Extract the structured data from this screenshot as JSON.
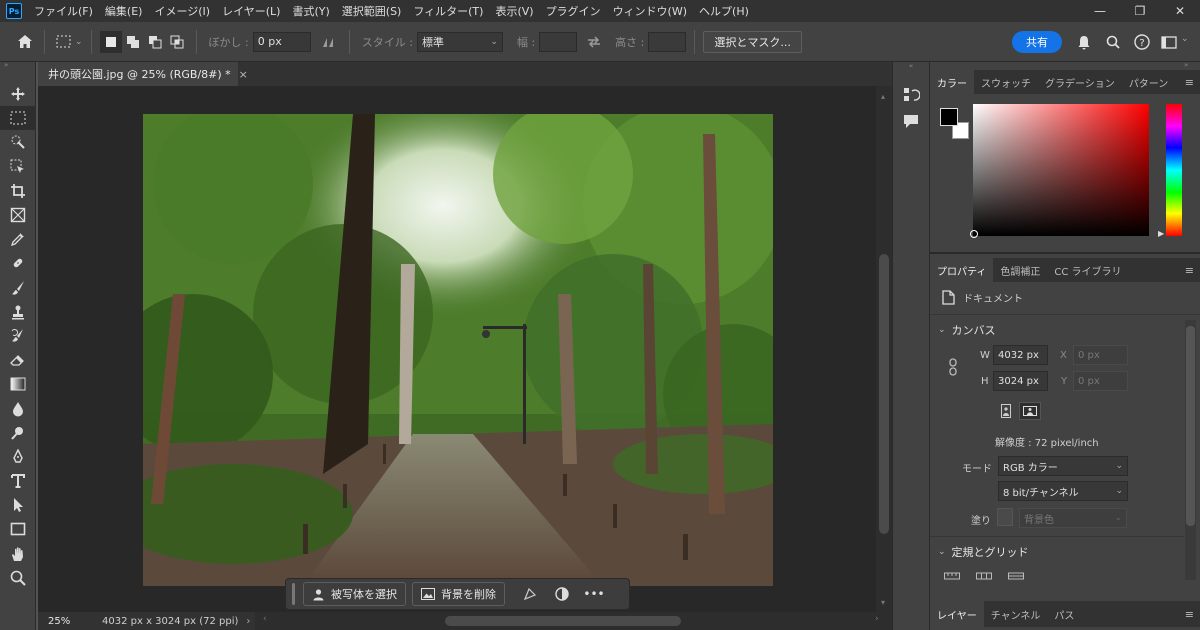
{
  "menu": {
    "logo": "Ps",
    "items": [
      "ファイル(F)",
      "編集(E)",
      "イメージ(I)",
      "レイヤー(L)",
      "書式(Y)",
      "選択範囲(S)",
      "フィルター(T)",
      "表示(V)",
      "プラグイン",
      "ウィンドウ(W)",
      "ヘルプ(H)"
    ],
    "window_controls": [
      "—",
      "❐",
      "✕"
    ]
  },
  "options": {
    "blur_label": "ぼかし :",
    "blur_value": "0 px",
    "style_label": "スタイル :",
    "style_value": "標準",
    "width_label": "幅 :",
    "height_label": "高さ :",
    "select_mask_button": "選択とマスク...",
    "share_button": "共有"
  },
  "document": {
    "tab_title": "井の頭公園.jpg @ 25% (RGB/8#) *",
    "tab_close": "×",
    "zoom": "25%",
    "status": "4032 px x 3024 px (72 ppi)"
  },
  "context_bar": {
    "select_subject": "被写体を選択",
    "remove_background": "背景を削除",
    "more": "•••"
  },
  "color_panel": {
    "tabs": [
      "カラー",
      "スウォッチ",
      "グラデーション",
      "パターン"
    ],
    "foreground": "#000000",
    "background": "#ffffff",
    "hue": "#ff0000"
  },
  "properties_panel": {
    "tabs": [
      "プロパティ",
      "色調補正",
      "CC ライブラリ"
    ],
    "doc_label": "ドキュメント",
    "canvas_heading": "カンバス",
    "w_label": "W",
    "w_value": "4032 px",
    "h_label": "H",
    "h_value": "3024 px",
    "x_label": "X",
    "x_placeholder": "0 px",
    "y_label": "Y",
    "y_placeholder": "0 px",
    "resolution": "解像度 : 72 pixel/inch",
    "mode_label": "モード",
    "mode_value": "RGB カラー",
    "depth_value": "8 bit/チャンネル",
    "fill_label": "塗り",
    "fill_value": "背景色",
    "guides_heading": "定規とグリッド"
  },
  "layers_panel": {
    "tabs": [
      "レイヤー",
      "チャンネル",
      "パス"
    ]
  }
}
